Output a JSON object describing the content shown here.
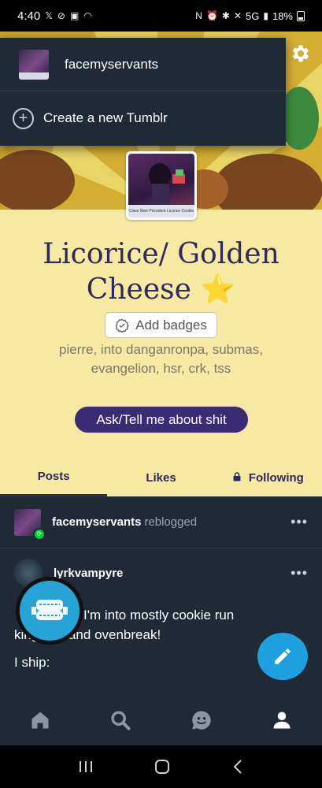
{
  "status_bar": {
    "time": "4:40",
    "network": "5G",
    "battery": "18%"
  },
  "account_menu": {
    "account_name": "facemyservants",
    "create_label": "Create a new Tumblr"
  },
  "profile": {
    "title": "Licorice/ Golden Cheese",
    "title_emoji": "⭐",
    "avatar_caption": "Class Nine President Licorice Cookie",
    "badges_label": "Add badges",
    "bio_line1": "pierre, into danganronpa, submas,",
    "bio_line2": "evangelion, hsr, crk, tss",
    "ask_label": "Ask/Tell me about shit"
  },
  "tabs": [
    {
      "label": "Posts",
      "active": true
    },
    {
      "label": "Likes",
      "active": false
    },
    {
      "label": "Following",
      "active": false,
      "locked": true
    }
  ],
  "post": {
    "reblogger": "facemyservants",
    "action": "reblogged",
    "author": "lyrkvampyre",
    "text_line1": "I'm into mostly cookie run",
    "text_line2": "kingdom and ovenbreak!",
    "text_line3": "I ship:"
  },
  "colors": {
    "accent_blue": "#1e9fe0",
    "title_ink": "#2e2a5a",
    "profile_bg": "#f5e9a3",
    "ask_button": "#3b2b72",
    "feed_bg": "#1f2a36"
  },
  "icons": {
    "gear": "gear-icon",
    "plus": "plus-circle-icon",
    "badge": "badge-icon",
    "lock": "lock-icon",
    "dots": "more-dots-icon",
    "reblog": "reblog-icon",
    "pencil": "pencil-icon",
    "home": "home-icon",
    "search": "search-icon",
    "chat": "chat-icon",
    "account": "account-icon"
  }
}
